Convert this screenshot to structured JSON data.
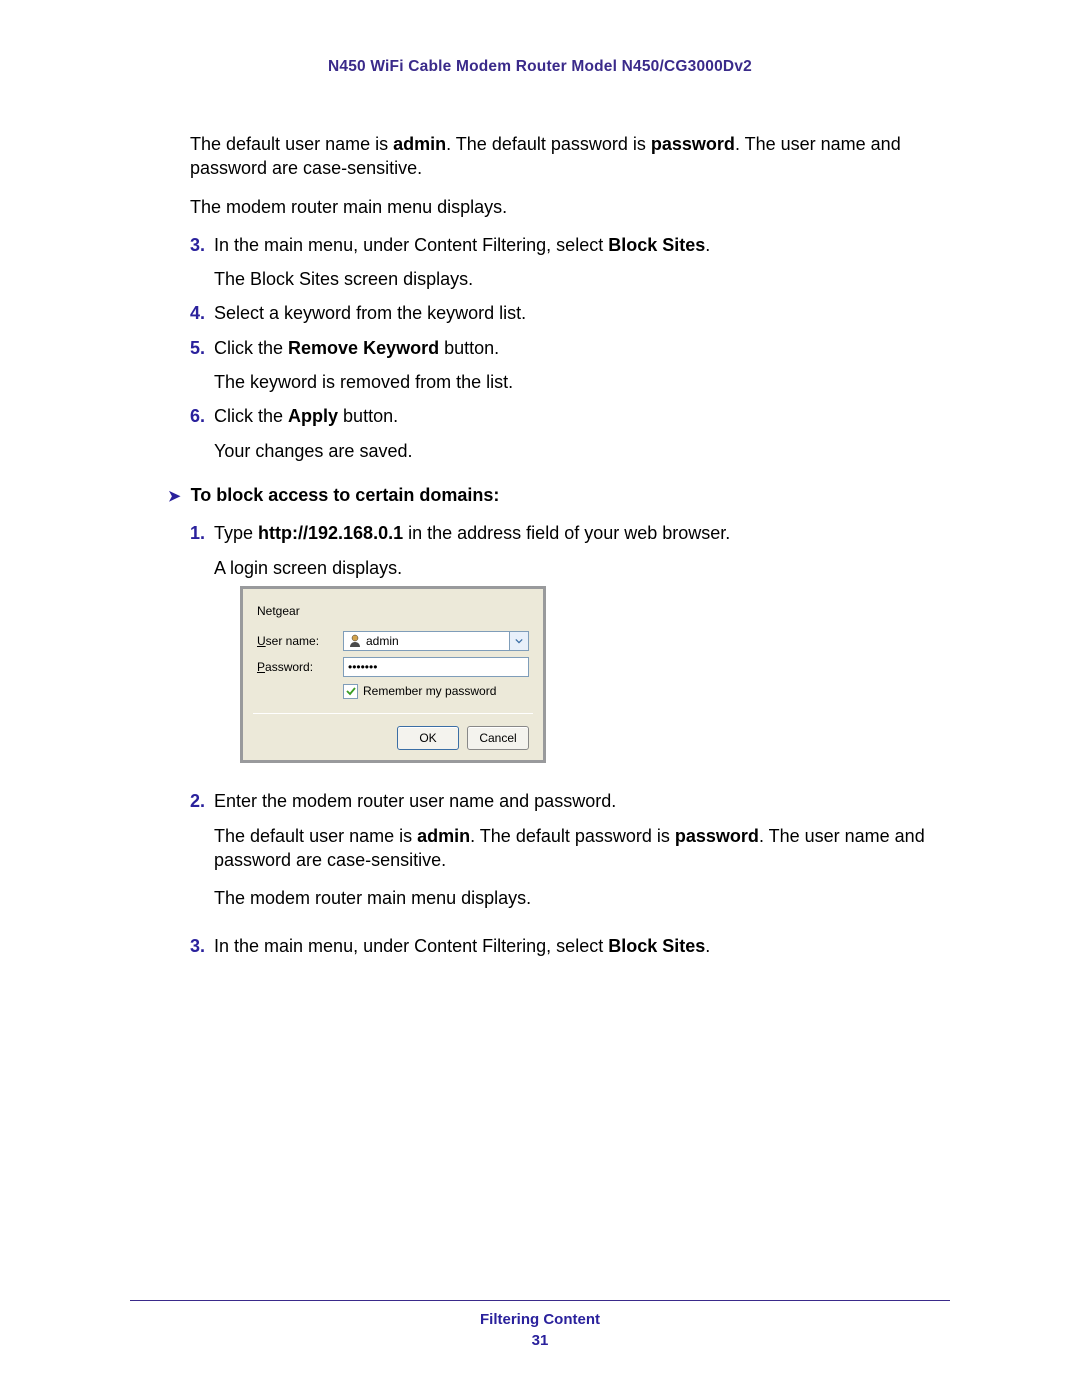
{
  "header": {
    "title": "N450 WiFi Cable Modem Router Model N450/CG3000Dv2"
  },
  "intro": {
    "p1a": "The default user name is ",
    "p1b": "admin",
    "p1c": ". The default password is ",
    "p1d": "password",
    "p1e": ". The user name and password are case-sensitive.",
    "p2": "The modem router main menu displays."
  },
  "steps_a": {
    "s3_num": "3.",
    "s3a": "In the main menu, under Content Filtering, select ",
    "s3b": "Block Sites",
    "s3c": ".",
    "s3_sub": "The Block Sites screen displays.",
    "s4_num": "4.",
    "s4": "Select a keyword from the keyword list.",
    "s5_num": "5.",
    "s5a": "Click the ",
    "s5b": "Remove Keyword",
    "s5c": " button.",
    "s5_sub": "The keyword is removed from the list.",
    "s6_num": "6.",
    "s6a": "Click the ",
    "s6b": "Apply",
    "s6c": " button.",
    "s6_sub": "Your changes are saved."
  },
  "section_b": {
    "arrow": "➤",
    "title": "To block access to certain domains:",
    "s1_num": "1.",
    "s1a": "Type ",
    "s1b": "http://192.168.0.1",
    "s1c": " in the address field of your web browser.",
    "s1_sub": "A login screen displays.",
    "s2_num": "2.",
    "s2": "Enter the modem router user name and password.",
    "s2_p1a": "The default user name is ",
    "s2_p1b": "admin",
    "s2_p1c": ". The default password is ",
    "s2_p1d": "password",
    "s2_p1e": ". The user name and password are case-sensitive.",
    "s2_p2": "The modem router main menu displays.",
    "s3_num": "3.",
    "s3a": "In the main menu, under Content Filtering, select ",
    "s3b": "Block Sites",
    "s3c": "."
  },
  "login_dialog": {
    "brand": "Netgear",
    "username_label_u": "U",
    "username_label_rest": "ser name:",
    "username_value": "admin",
    "password_label_u": "P",
    "password_label_rest": "assword:",
    "password_value": "•••••••",
    "remember_u": "R",
    "remember_rest": "emember my password",
    "ok": "OK",
    "cancel": "Cancel"
  },
  "footer": {
    "section": "Filtering Content",
    "page": "31"
  }
}
